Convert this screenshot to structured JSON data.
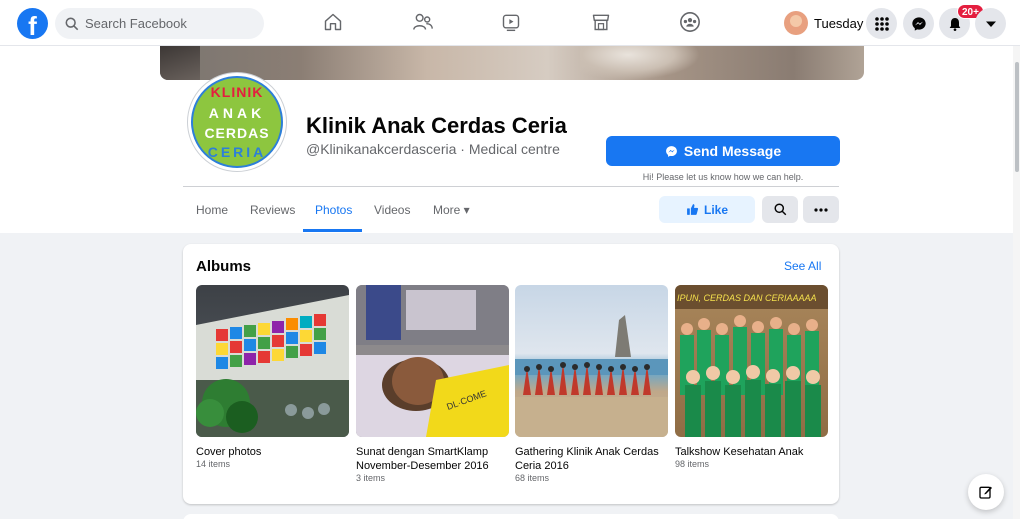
{
  "topbar": {
    "search_placeholder": "Search Facebook",
    "profile_name": "Tuesday",
    "notification_count": "20+",
    "nav_icons": [
      "home-icon",
      "friends-icon",
      "watch-icon",
      "marketplace-icon",
      "groups-icon"
    ]
  },
  "page": {
    "logo_lines": [
      "KLINIK",
      "ANAK",
      "CERDAS",
      "CERIA"
    ],
    "name": "Klinik Anak Cerdas Ceria",
    "handle": "@Klinikanakcerdasceria · Medical centre",
    "send_label": "Send Message",
    "send_hint": "Hi! Please let us know how we can help.",
    "like_label": "Like"
  },
  "tabs": [
    {
      "label": "Home"
    },
    {
      "label": "Reviews"
    },
    {
      "label": "Photos",
      "active": true
    },
    {
      "label": "Videos"
    },
    {
      "label": "More ▾"
    }
  ],
  "albums": {
    "title": "Albums",
    "see_all": "See All",
    "items": [
      {
        "name": "Cover photos",
        "count": "14 items"
      },
      {
        "name": "Sunat dengan SmartKlamp November-Desember 2016",
        "count": "3 items"
      },
      {
        "name": "Gathering Klinik Anak Cerdas Ceria 2016",
        "count": "68 items"
      },
      {
        "name": "Talkshow Kesehatan Anak",
        "count": "98 items"
      }
    ],
    "banner_text": "IPUN, CERDAS DAN CERIAAAAA"
  },
  "colors": {
    "brand": "#1877f2",
    "badge": "#e41e3f"
  }
}
